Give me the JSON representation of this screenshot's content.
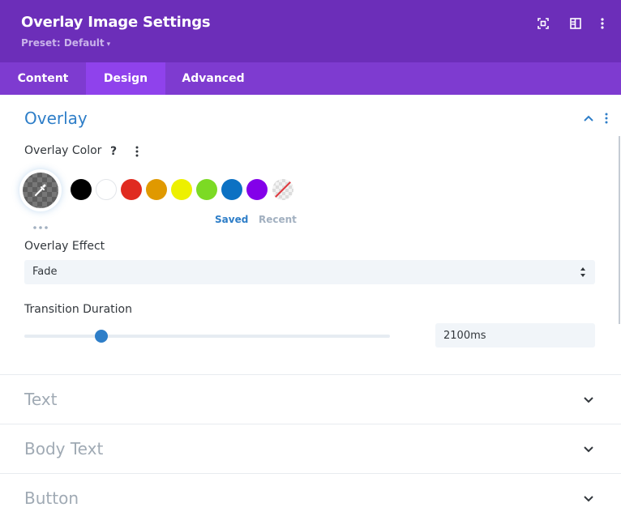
{
  "header": {
    "title": "Overlay Image Settings",
    "preset_label": "Preset: Default",
    "icons": [
      "expand-icon",
      "split-view-icon",
      "more-vertical-icon"
    ],
    "background": "#6c2eb9"
  },
  "tabs": [
    {
      "label": "Content",
      "active": false
    },
    {
      "label": "Design",
      "active": true
    },
    {
      "label": "Advanced",
      "active": false
    }
  ],
  "overlay_section": {
    "title": "Overlay",
    "expanded": true,
    "overlay_color": {
      "label": "Overlay Color",
      "help_glyph": "?",
      "palette": [
        "#000000",
        "#ffffff",
        "#e02b20",
        "#e09900",
        "#edf000",
        "#7cda24",
        "#0c71c3",
        "#8300e9"
      ],
      "saved_label": "Saved",
      "recent_label": "Recent"
    },
    "overlay_effect": {
      "label": "Overlay Effect",
      "value": "Fade"
    },
    "transition_duration": {
      "label": "Transition Duration",
      "value": "2100ms",
      "slider_fraction": 0.21
    }
  },
  "collapsed_sections": [
    {
      "title": "Text"
    },
    {
      "title": "Body Text"
    },
    {
      "title": "Button"
    }
  ],
  "colors": {
    "accent": "#2e7ec8",
    "tab_bar": "#7e3bd0",
    "active_tab": "#8f42ec"
  }
}
